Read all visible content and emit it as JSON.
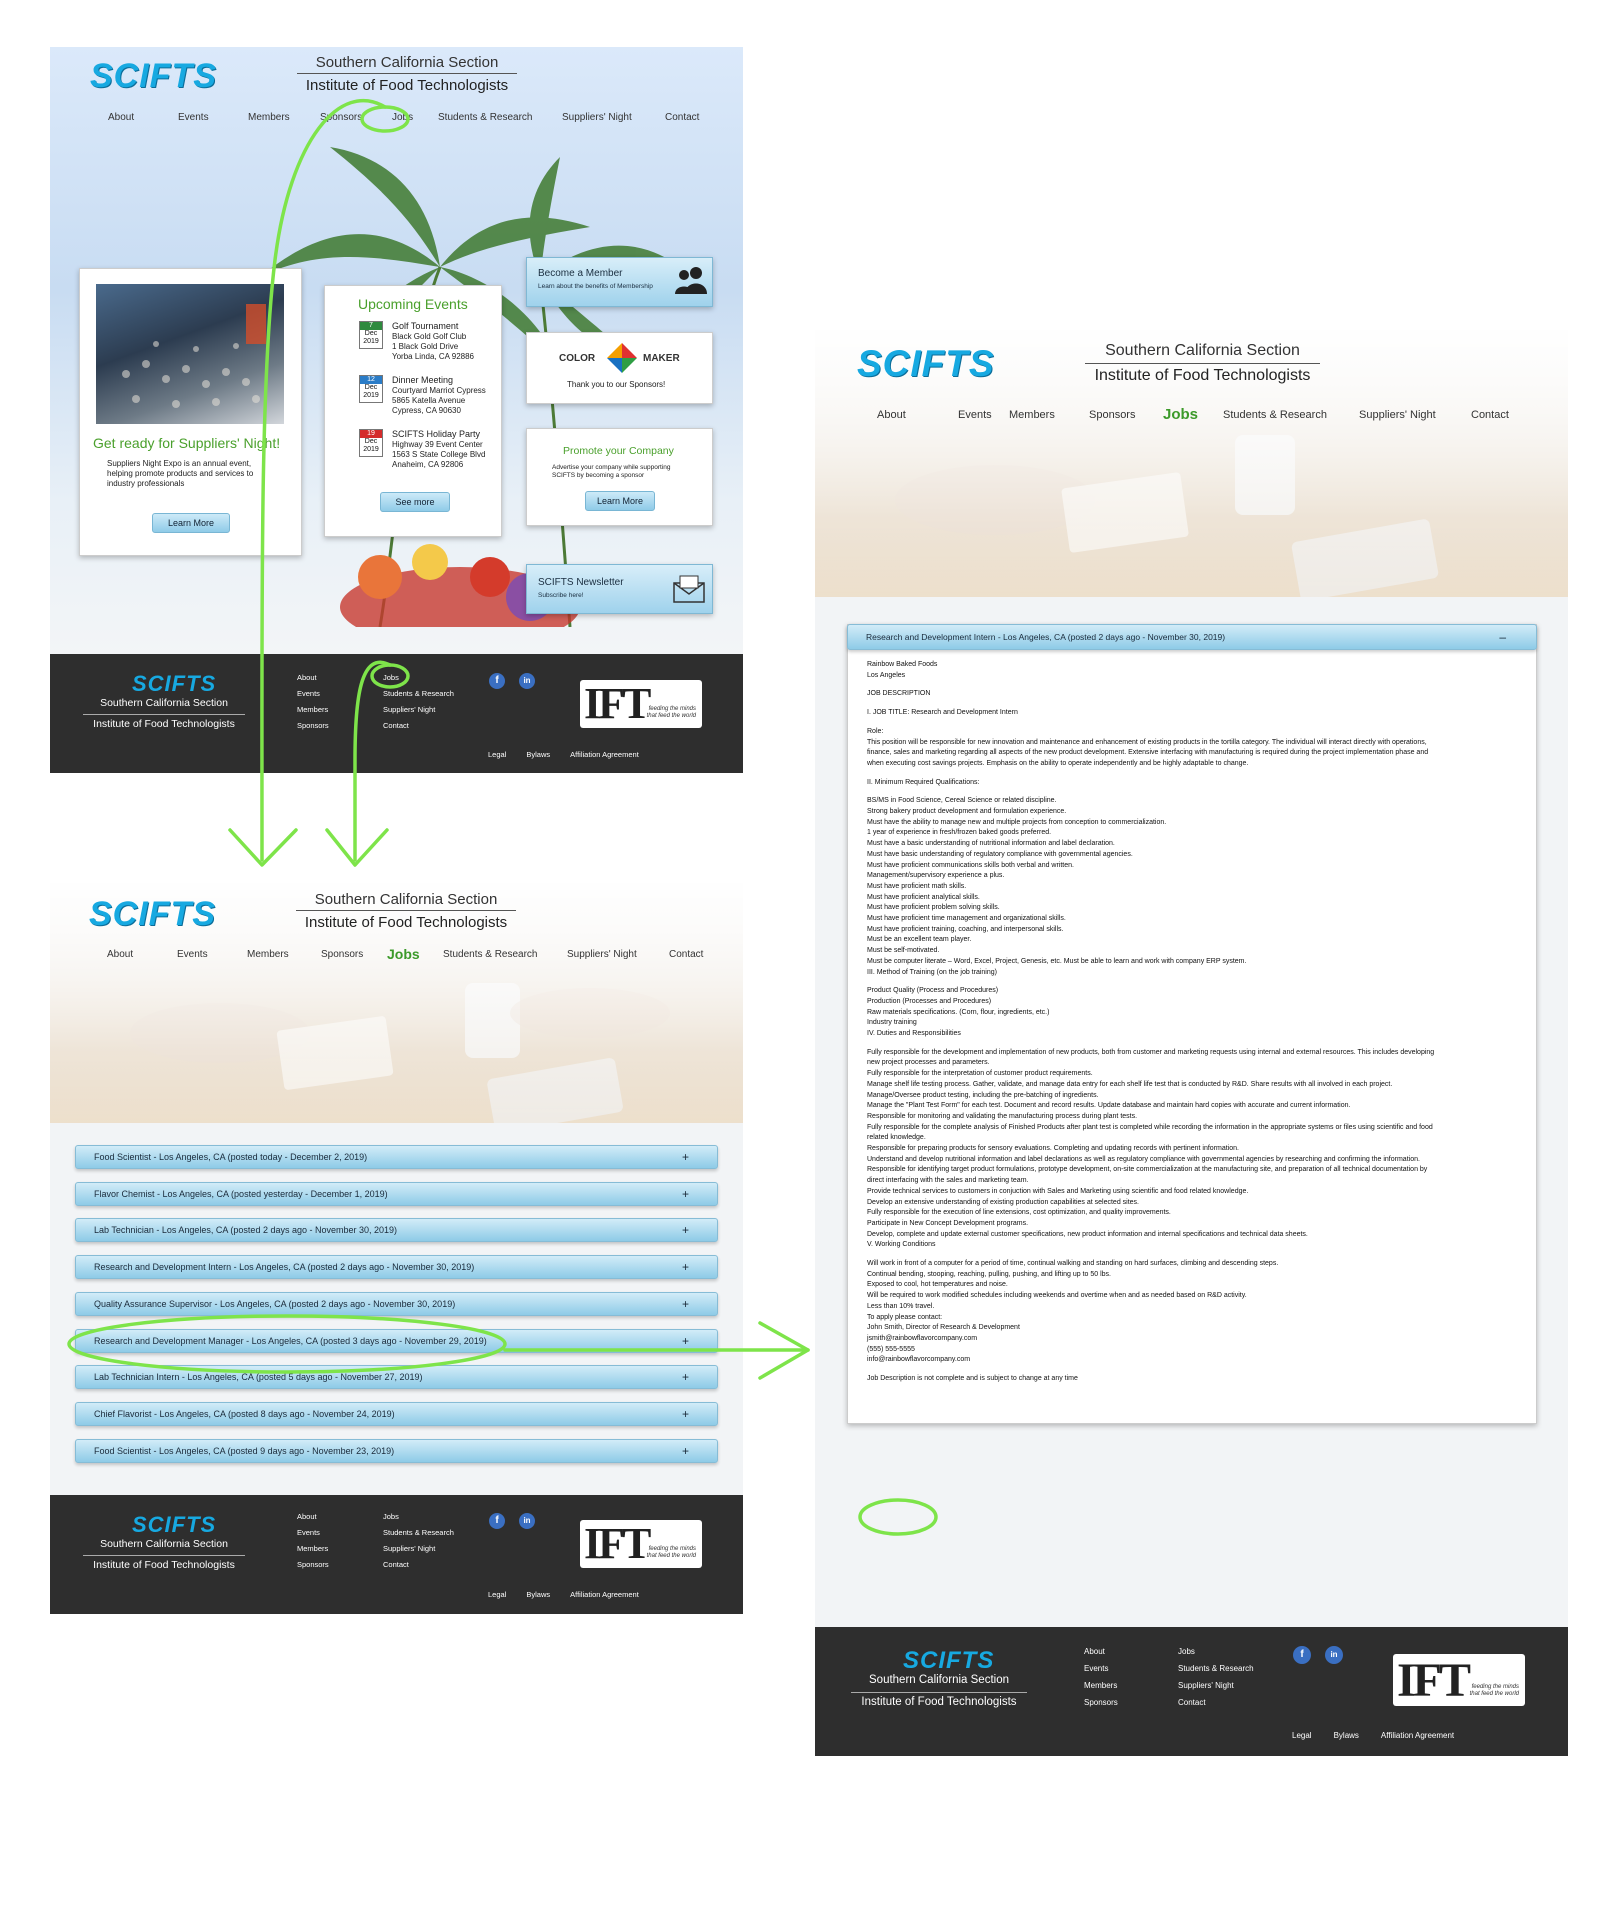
{
  "site": {
    "brand": "SCIFTS",
    "section": "Southern California Section",
    "institute": "Institute of Food Technologists"
  },
  "nav": [
    "About",
    "Events",
    "Members",
    "Sponsors",
    "Jobs",
    "Students & Research",
    "Suppliers' Night",
    "Contact"
  ],
  "home": {
    "suppliers": {
      "title": "Get ready for Suppliers' Night!",
      "text": "Suppliers Night Expo is an annual event, helping promote products and services to industry professionals",
      "button": "Learn More"
    },
    "events": {
      "title": "Upcoming Events",
      "items": [
        {
          "day": "7",
          "month": "Dec",
          "year": "2019",
          "color": "#2e8a3e",
          "name": "Golf Tournament",
          "lines": [
            "Black Gold Golf Club",
            "1 Black Gold Drive",
            "Yorba Linda, CA 92886"
          ]
        },
        {
          "day": "12",
          "month": "Dec",
          "year": "2019",
          "color": "#2a7cc7",
          "name": "Dinner Meeting",
          "lines": [
            "Courtyard Marriot Cypress",
            "5865 Katella Avenue",
            "Cypress, CA 90630"
          ]
        },
        {
          "day": "19",
          "month": "Dec",
          "year": "2019",
          "color": "#d42b2b",
          "name": "SCIFTS Holiday Party",
          "lines": [
            "Highway 39 Event Center",
            "1563 S State College Blvd",
            "Anaheim, CA 92806"
          ]
        }
      ],
      "button": "See more"
    },
    "member": {
      "title": "Become a Member",
      "sub": "Learn about the benefits of Membership"
    },
    "sponsor": {
      "left": "COLOR",
      "right": "MAKER",
      "text": "Thank you to our Sponsors!"
    },
    "promote": {
      "title": "Promote your Company",
      "text": "Advertise your company while supporting SCIFTS by becoming a sponsor",
      "button": "Learn More"
    },
    "newsletter": {
      "title": "SCIFTS Newsletter",
      "sub": "Subscribe here!"
    }
  },
  "footer": {
    "col1": [
      "About",
      "Events",
      "Members",
      "Sponsors"
    ],
    "col2": [
      "Jobs",
      "Students & Research",
      "Suppliers' Night",
      "Contact"
    ],
    "social": [
      "f",
      "in"
    ],
    "ift": {
      "logo": "IFT",
      "tag1": "feeding the minds",
      "tag2": "that feed the world"
    },
    "legal": [
      "Legal",
      "Bylaws",
      "Affiliation Agreement"
    ]
  },
  "jobs": [
    "Food Scientist - Los Angeles, CA (posted today - December 2, 2019)",
    "Flavor Chemist - Los Angeles, CA (posted yesterday - December 1, 2019)",
    "Lab Technician - Los Angeles, CA (posted 2 days ago - November 30, 2019)",
    "Research and Development Intern - Los Angeles, CA (posted 2 days ago - November 30, 2019)",
    "Quality Assurance Supervisor - Los Angeles, CA (posted 2 days ago - November 30, 2019)",
    "Research and Development Manager - Los Angeles, CA (posted 3 days ago - November 29, 2019)",
    "Lab Technician Intern - Los Angeles, CA (posted 5 days ago - November 27, 2019)",
    "Chief Flavorist - Los Angeles, CA (posted 8 days ago - November 24, 2019)",
    "Food Scientist - Los Angeles, CA (posted 9 days ago - November 23, 2019)"
  ],
  "plus": "+",
  "minus": "–",
  "detail": {
    "title": "Research and Development Intern - Los Angeles, CA (posted 2 days ago - November 30, 2019)",
    "lines": [
      "Rainbow Baked Foods",
      "Los Angeles",
      "",
      "JOB DESCRIPTION",
      "",
      "I. JOB TITLE: Research and Development Intern",
      "",
      "Role:",
      "This position will be responsible for new innovation and maintenance and enhancement of existing products in the tortilla category.  The individual will  interact directly with operations,",
      "finance, sales and marketing regarding all aspects of the new product development.  Extensive interfacing with manufacturing is required during the project implementation phase and",
      "when executing cost savings projects.  Emphasis on the ability to operate independently and be highly adaptable to change.",
      "",
      "II.  Minimum Required Qualifications:",
      "",
      "BS/MS in Food Science, Cereal Science or related discipline.",
      "Strong bakery product development and formulation experience.",
      "Must have the ability to manage new and multiple projects from conception to commercialization.",
      "1 year of experience in fresh/frozen baked goods preferred.",
      "Must have a basic understanding of nutritional information and label declaration.",
      "Must have basic understanding of regulatory compliance with governmental agencies.",
      "Must have proficient communications skills both verbal and written.",
      "Management/supervisory experience a plus.",
      "Must have proficient math skills.",
      "Must have proficient analytical skills.",
      "Must have proficient problem solving skills.",
      "Must have proficient time management and organizational skills.",
      "Must have proficient training, coaching, and interpersonal skills.",
      "Must be an excellent team player.",
      "Must be self-motivated.",
      "Must be computer literate – Word, Excel, Project, Genesis, etc. Must be able to learn and work with company ERP system.",
      "III.  Method of Training (on the job training)",
      "",
      "Product Quality (Process and Procedures)",
      "Production (Processes and Procedures)",
      "Raw materials specifications. (Corn, flour, ingredients, etc.)",
      "Industry training",
      "IV.  Duties and Responsibilities",
      "",
      "Fully responsible for the development and implementation of new products, both from customer and marketing requests using internal and external resources.  This includes developing",
      "new project processes and parameters.",
      "Fully responsible for the interpretation of customer product requirements.",
      "Manage shelf life testing process. Gather, validate, and manage data entry for each shelf life test that is conducted by R&D. Share results with all involved in each project.",
      "Manage/Oversee product testing, including the pre-batching of ingredients.",
      "Manage the \"Plant Test Form\" for each test.  Document and record results. Update database and maintain hard copies with accurate and current information.",
      "Responsible for monitoring and validating the manufacturing process during plant tests.",
      "Fully responsible for the complete analysis of Finished Products after plant test is completed while recording the information in the appropriate systems or files using scientific and food",
      "related knowledge.",
      "Responsible for preparing products for sensory evaluations. Completing and updating records with pertinent information.",
      "Understand and develop nutritional information and label declarations as well as regulatory compliance with governmental agencies by researching and confirming the information.",
      "Responsible for identifying target product formulations, prototype development, on-site commercialization at the manufacturing site, and preparation of all technical documentation by",
      "direct interfacing with the sales and marketing team.",
      "Provide technical services to customers in conjuction with Sales and Marketing using scientific and food related knowledge.",
      "Develop an extensive understanding of existing production capabilities at selected sites.",
      "Fully responsible for the execution of line extensions, cost optimization, and quality improvements.",
      "Participate in New Concept Development programs.",
      "Develop, complete and update external customer specifications, new product information and internal specifications and technical data sheets.",
      "V.  Working Conditions",
      "",
      "Will work in front of a computer for a period of time, continual walking and standing on hard surfaces, climbing and descending steps.",
      "Continual bending, stooping, reaching, pulling, pushing, and lifting up to 50 lbs.",
      "Exposed to cool, hot temperatures and noise.",
      "Will be required to work modified schedules including weekends and overtime when and as needed based on R&D activity.",
      "Less than 10% travel.",
      "To apply please contact:",
      "John Smith, Director of Research & Development",
      "jsmith@rainbowflavorcompany.com",
      "(555) 555-5555",
      "info@rainbowflavorcompany.com",
      "",
      "Job Description is not complete and is subject to change at any time"
    ]
  }
}
